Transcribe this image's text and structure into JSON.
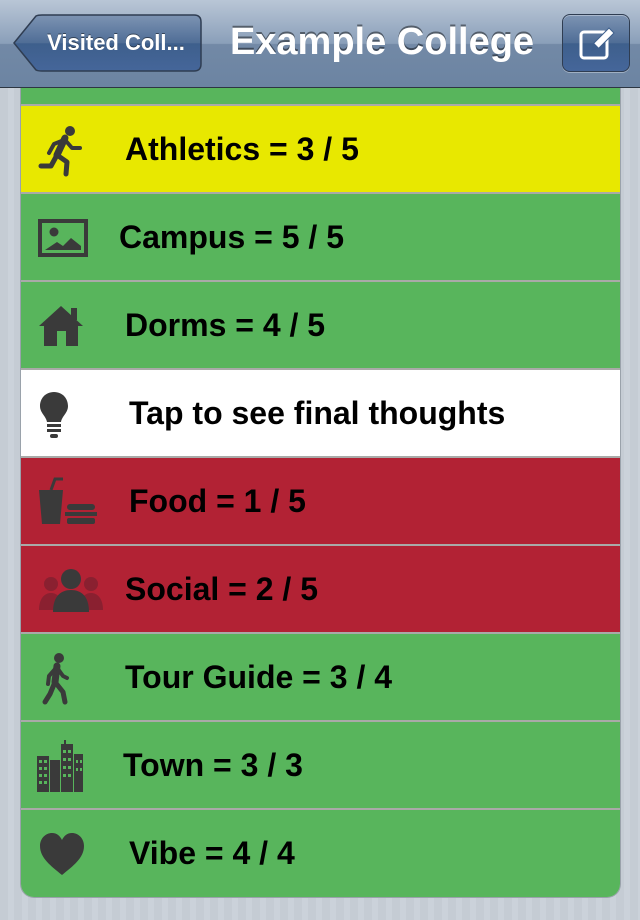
{
  "navbar": {
    "back_label": "Visited Coll...",
    "title": "Example College"
  },
  "colors": {
    "green": "#58b55c",
    "yellow": "#e8e800",
    "red": "#b22234",
    "white": "#ffffff",
    "icon": "#3a3a3a"
  },
  "rows": [
    {
      "label": "Athletics = 3 / 5",
      "icon": "running-person-icon",
      "color": "yellow"
    },
    {
      "label": "Campus = 5 / 5",
      "icon": "picture-icon",
      "color": "green"
    },
    {
      "label": "Dorms = 4 / 5",
      "icon": "house-icon",
      "color": "green"
    },
    {
      "label": "Tap to see final thoughts",
      "icon": "lightbulb-icon",
      "color": "white"
    },
    {
      "label": "Food = 1 / 5",
      "icon": "food-drink-icon",
      "color": "red"
    },
    {
      "label": "Social = 2 / 5",
      "icon": "people-group-icon",
      "color": "red"
    },
    {
      "label": "Tour Guide = 3 / 4",
      "icon": "walking-person-icon",
      "color": "green"
    },
    {
      "label": "Town = 3 / 3",
      "icon": "city-buildings-icon",
      "color": "green"
    },
    {
      "label": "Vibe = 4 / 4",
      "icon": "heart-icon",
      "color": "green"
    }
  ]
}
